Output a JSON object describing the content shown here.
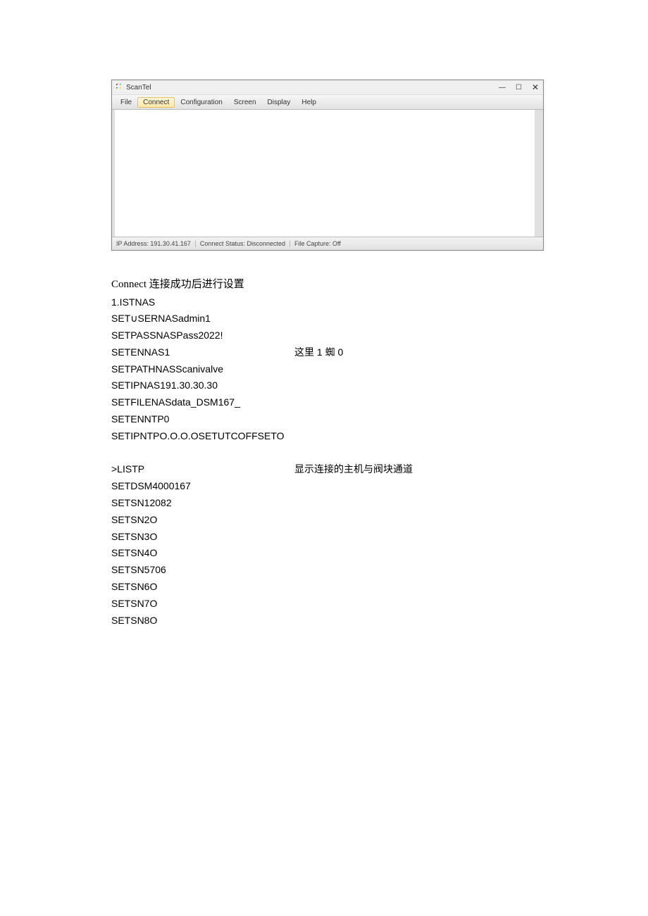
{
  "app": {
    "title": "ScanTel",
    "menu": {
      "file": "File",
      "connect": "Connect",
      "configuration": "Configuration",
      "screen": "Screen",
      "display": "Display",
      "help": "Help"
    },
    "status": {
      "ip": "IP Address: 191.30.41.167",
      "conn": "Connect Status: Disconnected",
      "cap": "File Capture: Off"
    },
    "win": {
      "min": "—",
      "max": "☐",
      "close": "✕"
    }
  },
  "doc": {
    "heading": "Connect 连接成功后进行设置",
    "l1": "1.ISTNAS",
    "l2": "SET∪SERNASadmin1",
    "l3": "SETPASSNASPass2022!",
    "l4a": "SETENNAS1",
    "l4b": "这里 1 蜘 0",
    "l5": "SETPATHNASScanivalve",
    "l6": "SETIPNAS191.30.30.30",
    "l7": "SETFILENASdata_DSM167_",
    "l8": "SETENNTP0",
    "l9": "SETIPNTPO.O.O.OSETUTCOFFSETO",
    "l10a": ">LISTP",
    "l10b": "显示连接的主机与阀块通道",
    "l11": "SETDSM4000167",
    "l12": "SETSN12082",
    "l13": "SETSN2O",
    "l14": "SETSN3O",
    "l15": "SETSN4O",
    "l16": "SETSN5706",
    "l17": "SETSN6O",
    "l18": "SETSN7O",
    "l19": "SETSN8O"
  }
}
